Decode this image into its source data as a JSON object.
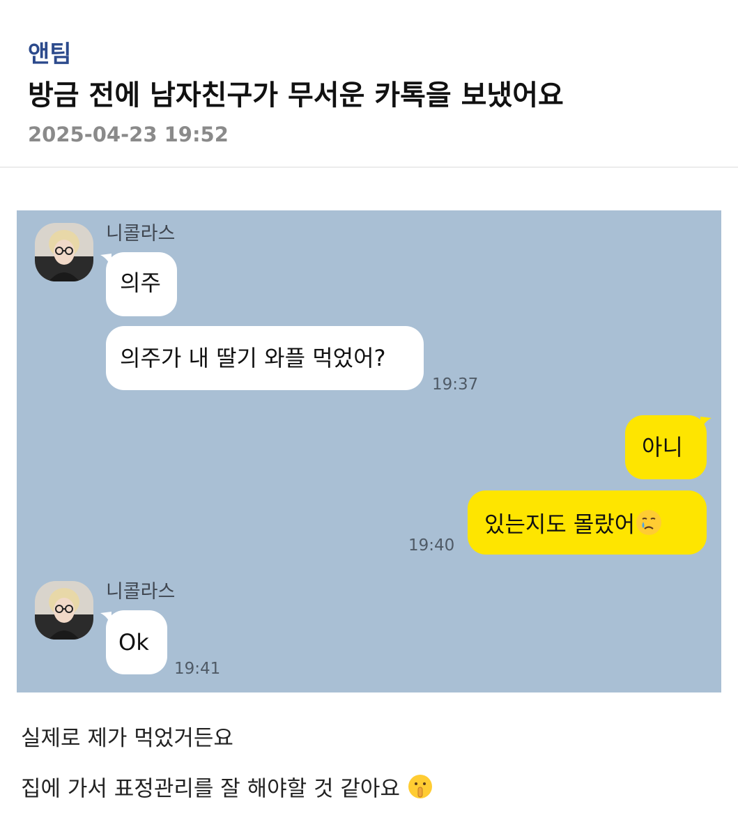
{
  "post": {
    "category": "앤팀",
    "title": "방금 전에 남자친구가 무서운 카톡을 보냈어요",
    "date": "2025-04-23 19:52"
  },
  "chat": {
    "background_color": "#a9bfd4",
    "groups": [
      {
        "sender": "니콜라스",
        "avatar_icon": "profile-photo",
        "messages": [
          "의주",
          "의주가 내 딸기 와플 먹었어?"
        ],
        "time": "19:37"
      },
      {
        "sender": "me",
        "messages": [
          "아니",
          "있는지도 몰랐어"
        ],
        "emoji": "crying-face-icon",
        "time": "19:40"
      },
      {
        "sender": "니콜라스",
        "avatar_icon": "profile-photo",
        "messages": [
          "Ok"
        ],
        "time": "19:41"
      }
    ]
  },
  "body": {
    "line1": "실제로 제가 먹었거든요",
    "line2": "집에 가서 표정관리를 잘 해야할 것 같아요",
    "line2_emoji": "shushing-face-icon"
  },
  "colors": {
    "accent": "#2c4a8c",
    "outgoing_bubble": "#fee500",
    "incoming_bubble": "#ffffff"
  }
}
